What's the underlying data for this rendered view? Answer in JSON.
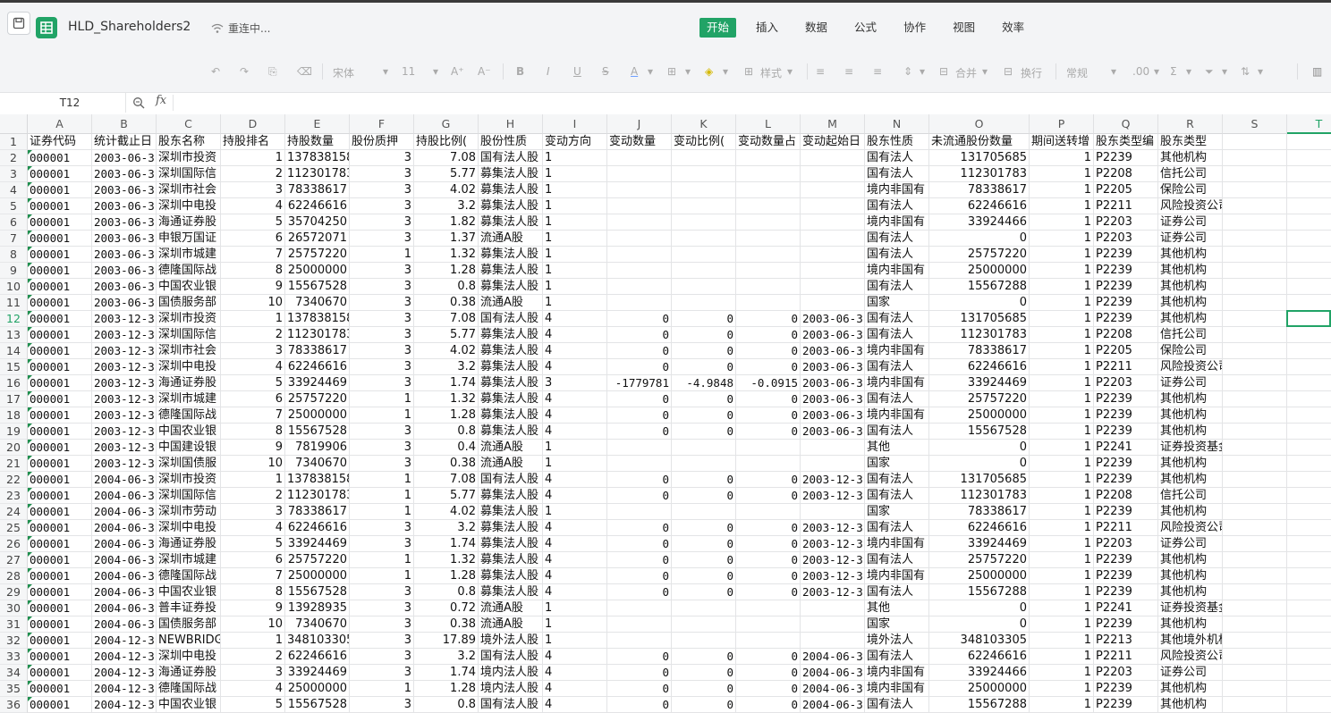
{
  "app": {
    "doc_title": "HLD_Shareholders2",
    "status": "重连中..."
  },
  "menu": [
    "开始",
    "插入",
    "数据",
    "公式",
    "协作",
    "视图",
    "效率"
  ],
  "menu_active": 0,
  "toolbar": {
    "font": "宋体",
    "size": "11",
    "style": "样式",
    "merge": "合并",
    "wrap": "换行",
    "numfmt": "常规"
  },
  "formula_bar": {
    "cell_ref": "T12",
    "fx": "fx",
    "value": ""
  },
  "selected_cell": "T12",
  "columns": [
    "A",
    "B",
    "C",
    "D",
    "E",
    "F",
    "G",
    "H",
    "I",
    "J",
    "K",
    "L",
    "M",
    "N",
    "O",
    "P",
    "Q",
    "R",
    "S",
    "T"
  ],
  "rows": [
    [
      "证券代码",
      "统计截止日",
      "股东名称",
      "持股排名",
      "持股数量",
      "股份质押",
      "持股比例(",
      "股份性质",
      "变动方向",
      "变动数量",
      "变动比例(",
      "变动数量占",
      "变动起始日",
      "股东性质",
      "未流通股份数量",
      "期间送转增",
      "股东类型编",
      "股东类型",
      "",
      ""
    ],
    [
      "000001",
      "2003-06-3",
      "深圳市投资",
      "1",
      "137838158",
      "3",
      "7.08",
      "国有法人股",
      "1",
      "",
      "",
      "",
      "",
      "国有法人",
      "131705685",
      "1",
      "P2239",
      "其他机构",
      "",
      ""
    ],
    [
      "000001",
      "2003-06-3",
      "深圳国际信",
      "2",
      "112301783",
      "3",
      "5.77",
      "募集法人股",
      "1",
      "",
      "",
      "",
      "",
      "国有法人",
      "112301783",
      "1",
      "P2208",
      "信托公司",
      "",
      ""
    ],
    [
      "000001",
      "2003-06-3",
      "深圳市社会",
      "3",
      "78338617",
      "3",
      "4.02",
      "募集法人股",
      "1",
      "",
      "",
      "",
      "",
      "境内非国有",
      "78338617",
      "1",
      "P2205",
      "保险公司",
      "",
      ""
    ],
    [
      "000001",
      "2003-06-3",
      "深圳中电投",
      "4",
      "62246616",
      "3",
      "3.2",
      "募集法人股",
      "1",
      "",
      "",
      "",
      "",
      "国有法人",
      "62246616",
      "1",
      "P2211",
      "风险投资公司",
      "",
      ""
    ],
    [
      "000001",
      "2003-06-3",
      "海通证券股",
      "5",
      "35704250",
      "3",
      "1.82",
      "募集法人股",
      "1",
      "",
      "",
      "",
      "",
      "境内非国有",
      "33924466",
      "1",
      "P2203",
      "证券公司",
      "",
      ""
    ],
    [
      "000001",
      "2003-06-3",
      "申银万国证",
      "6",
      "26572071",
      "3",
      "1.37",
      "流通A股",
      "1",
      "",
      "",
      "",
      "",
      "国有法人",
      "0",
      "1",
      "P2203",
      "证券公司",
      "",
      ""
    ],
    [
      "000001",
      "2003-06-3",
      "深圳市城建",
      "7",
      "25757220",
      "1",
      "1.32",
      "募集法人股",
      "1",
      "",
      "",
      "",
      "",
      "国有法人",
      "25757220",
      "1",
      "P2239",
      "其他机构",
      "",
      ""
    ],
    [
      "000001",
      "2003-06-3",
      "德隆国际战",
      "8",
      "25000000",
      "3",
      "1.28",
      "募集法人股",
      "1",
      "",
      "",
      "",
      "",
      "境内非国有",
      "25000000",
      "1",
      "P2239",
      "其他机构",
      "",
      ""
    ],
    [
      "000001",
      "2003-06-3",
      "中国农业银",
      "9",
      "15567528",
      "3",
      "0.8",
      "募集法人股",
      "1",
      "",
      "",
      "",
      "",
      "国有法人",
      "15567288",
      "1",
      "P2239",
      "其他机构",
      "",
      ""
    ],
    [
      "000001",
      "2003-06-3",
      "国债服务部",
      "10",
      "7340670",
      "3",
      "0.38",
      "流通A股",
      "1",
      "",
      "",
      "",
      "",
      "国家",
      "0",
      "1",
      "P2239",
      "其他机构",
      "",
      ""
    ],
    [
      "000001",
      "2003-12-3",
      "深圳市投资",
      "1",
      "137838158",
      "3",
      "7.08",
      "国有法人股",
      "4",
      "0",
      "0",
      "0",
      "2003-06-3",
      "国有法人",
      "131705685",
      "1",
      "P2239",
      "其他机构",
      "",
      ""
    ],
    [
      "000001",
      "2003-12-3",
      "深圳国际信",
      "2",
      "112301783",
      "3",
      "5.77",
      "募集法人股",
      "4",
      "0",
      "0",
      "0",
      "2003-06-3",
      "国有法人",
      "112301783",
      "1",
      "P2208",
      "信托公司",
      "",
      ""
    ],
    [
      "000001",
      "2003-12-3",
      "深圳市社会",
      "3",
      "78338617",
      "3",
      "4.02",
      "募集法人股",
      "4",
      "0",
      "0",
      "0",
      "2003-06-3",
      "境内非国有",
      "78338617",
      "1",
      "P2205",
      "保险公司",
      "",
      ""
    ],
    [
      "000001",
      "2003-12-3",
      "深圳中电投",
      "4",
      "62246616",
      "3",
      "3.2",
      "募集法人股",
      "4",
      "0",
      "0",
      "0",
      "2003-06-3",
      "国有法人",
      "62246616",
      "1",
      "P2211",
      "风险投资公司",
      "",
      ""
    ],
    [
      "000001",
      "2003-12-3",
      "海通证券股",
      "5",
      "33924469",
      "3",
      "1.74",
      "募集法人股",
      "3",
      "-1779781",
      "-4.9848",
      "-0.0915",
      "2003-06-3",
      "境内非国有",
      "33924469",
      "1",
      "P2203",
      "证券公司",
      "",
      ""
    ],
    [
      "000001",
      "2003-12-3",
      "深圳市城建",
      "6",
      "25757220",
      "1",
      "1.32",
      "募集法人股",
      "4",
      "0",
      "0",
      "0",
      "2003-06-3",
      "国有法人",
      "25757220",
      "1",
      "P2239",
      "其他机构",
      "",
      ""
    ],
    [
      "000001",
      "2003-12-3",
      "德隆国际战",
      "7",
      "25000000",
      "1",
      "1.28",
      "募集法人股",
      "4",
      "0",
      "0",
      "0",
      "2003-06-3",
      "境内非国有",
      "25000000",
      "1",
      "P2239",
      "其他机构",
      "",
      ""
    ],
    [
      "000001",
      "2003-12-3",
      "中国农业银",
      "8",
      "15567528",
      "3",
      "0.8",
      "募集法人股",
      "4",
      "0",
      "0",
      "0",
      "2003-06-3",
      "国有法人",
      "15567528",
      "1",
      "P2239",
      "其他机构",
      "",
      ""
    ],
    [
      "000001",
      "2003-12-3",
      "中国建设银",
      "9",
      "7819906",
      "3",
      "0.4",
      "流通A股",
      "1",
      "",
      "",
      "",
      "",
      "其他",
      "0",
      "1",
      "P2241",
      "证券投资基金",
      "",
      ""
    ],
    [
      "000001",
      "2003-12-3",
      "深圳国债服",
      "10",
      "7340670",
      "3",
      "0.38",
      "流通A股",
      "1",
      "",
      "",
      "",
      "",
      "国家",
      "0",
      "1",
      "P2239",
      "其他机构",
      "",
      ""
    ],
    [
      "000001",
      "2004-06-3",
      "深圳市投资",
      "1",
      "137838158",
      "1",
      "7.08",
      "国有法人股",
      "4",
      "0",
      "0",
      "0",
      "2003-12-3",
      "国有法人",
      "131705685",
      "1",
      "P2239",
      "其他机构",
      "",
      ""
    ],
    [
      "000001",
      "2004-06-3",
      "深圳国际信",
      "2",
      "112301783",
      "1",
      "5.77",
      "募集法人股",
      "4",
      "0",
      "0",
      "0",
      "2003-12-3",
      "国有法人",
      "112301783",
      "1",
      "P2208",
      "信托公司",
      "",
      ""
    ],
    [
      "000001",
      "2004-06-3",
      "深圳市劳动",
      "3",
      "78338617",
      "1",
      "4.02",
      "募集法人股",
      "1",
      "",
      "",
      "",
      "",
      "国家",
      "78338617",
      "1",
      "P2239",
      "其他机构",
      "",
      ""
    ],
    [
      "000001",
      "2004-06-3",
      "深圳中电投",
      "4",
      "62246616",
      "3",
      "3.2",
      "募集法人股",
      "4",
      "0",
      "0",
      "0",
      "2003-12-3",
      "国有法人",
      "62246616",
      "1",
      "P2211",
      "风险投资公司",
      "",
      ""
    ],
    [
      "000001",
      "2004-06-3",
      "海通证券股",
      "5",
      "33924469",
      "3",
      "1.74",
      "募集法人股",
      "4",
      "0",
      "0",
      "0",
      "2003-12-3",
      "境内非国有",
      "33924469",
      "1",
      "P2203",
      "证券公司",
      "",
      ""
    ],
    [
      "000001",
      "2004-06-3",
      "深圳市城建",
      "6",
      "25757220",
      "1",
      "1.32",
      "募集法人股",
      "4",
      "0",
      "0",
      "0",
      "2003-12-3",
      "国有法人",
      "25757220",
      "1",
      "P2239",
      "其他机构",
      "",
      ""
    ],
    [
      "000001",
      "2004-06-3",
      "德隆国际战",
      "7",
      "25000000",
      "1",
      "1.28",
      "募集法人股",
      "4",
      "0",
      "0",
      "0",
      "2003-12-3",
      "境内非国有",
      "25000000",
      "1",
      "P2239",
      "其他机构",
      "",
      ""
    ],
    [
      "000001",
      "2004-06-3",
      "中国农业银",
      "8",
      "15567528",
      "3",
      "0.8",
      "募集法人股",
      "4",
      "0",
      "0",
      "0",
      "2003-12-3",
      "国有法人",
      "15567288",
      "1",
      "P2239",
      "其他机构",
      "",
      ""
    ],
    [
      "000001",
      "2004-06-3",
      "普丰证券投",
      "9",
      "13928935",
      "3",
      "0.72",
      "流通A股",
      "1",
      "",
      "",
      "",
      "",
      "其他",
      "0",
      "1",
      "P2241",
      "证券投资基金",
      "",
      ""
    ],
    [
      "000001",
      "2004-06-3",
      "国债服务部",
      "10",
      "7340670",
      "3",
      "0.38",
      "流通A股",
      "1",
      "",
      "",
      "",
      "",
      "国家",
      "0",
      "1",
      "P2239",
      "其他机构",
      "",
      ""
    ],
    [
      "000001",
      "2004-12-3",
      "NEWBRIDGE",
      "1",
      "348103305",
      "3",
      "17.89",
      "境外法人股",
      "1",
      "",
      "",
      "",
      "",
      "境外法人",
      "348103305",
      "1",
      "P2213",
      "其他境外机构",
      "",
      ""
    ],
    [
      "000001",
      "2004-12-3",
      "深圳中电投",
      "2",
      "62246616",
      "3",
      "3.2",
      "国有法人股",
      "4",
      "0",
      "0",
      "0",
      "2004-06-3",
      "国有法人",
      "62246616",
      "1",
      "P2211",
      "风险投资公司",
      "",
      ""
    ],
    [
      "000001",
      "2004-12-3",
      "海通证券股",
      "3",
      "33924469",
      "3",
      "1.74",
      "境内法人股",
      "4",
      "0",
      "0",
      "0",
      "2004-06-3",
      "境内非国有",
      "33924466",
      "1",
      "P2203",
      "证券公司",
      "",
      ""
    ],
    [
      "000001",
      "2004-12-3",
      "德隆国际战",
      "4",
      "25000000",
      "1",
      "1.28",
      "境内法人股",
      "4",
      "0",
      "0",
      "0",
      "2004-06-3",
      "境内非国有",
      "25000000",
      "1",
      "P2239",
      "其他机构",
      "",
      ""
    ],
    [
      "000001",
      "2004-12-3",
      "中国农业银",
      "5",
      "15567528",
      "3",
      "0.8",
      "国有法人股",
      "4",
      "0",
      "0",
      "0",
      "2004-06-3",
      "国有法人",
      "15567288",
      "1",
      "P2239",
      "其他机构",
      "",
      ""
    ]
  ]
}
